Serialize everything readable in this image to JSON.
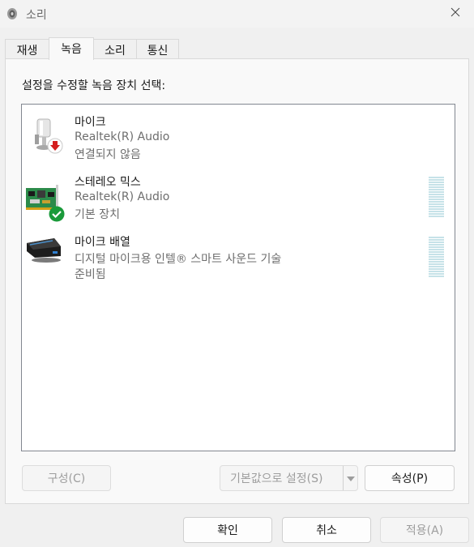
{
  "window": {
    "title": "소리",
    "title_icon": "speaker-icon",
    "close_icon": "close-icon"
  },
  "tabs": [
    {
      "label": "재생",
      "active": false
    },
    {
      "label": "녹음",
      "active": true
    },
    {
      "label": "소리",
      "active": false
    },
    {
      "label": "통신",
      "active": false
    }
  ],
  "instruction": "설정을 수정할 녹음 장치 선택:",
  "devices": [
    {
      "name": "마이크",
      "driver": "Realtek(R) Audio",
      "status": "연결되지 않음",
      "icon": "microphone-icon",
      "badge": "down-arrow-badge",
      "has_meter": false
    },
    {
      "name": "스테레오 믹스",
      "driver": "Realtek(R) Audio",
      "status": "기본 장치",
      "icon": "sound-card-icon",
      "badge": "checkmark-badge",
      "has_meter": true
    },
    {
      "name": "마이크 배열",
      "driver": "디지털 마이크용 인텔® 스마트 사운드 기술",
      "status": "준비됨",
      "icon": "microphone-array-icon",
      "badge": "",
      "has_meter": true
    }
  ],
  "buttons": {
    "configure": "구성(C)",
    "set_default": "기본값으로 설정(S)",
    "properties": "속성(P)",
    "ok": "확인",
    "cancel": "취소",
    "apply": "적용(A)"
  },
  "colors": {
    "meter": "#c6e2e8",
    "check_badge": "#1a9a3a",
    "warning_badge": "#d41e1e"
  }
}
